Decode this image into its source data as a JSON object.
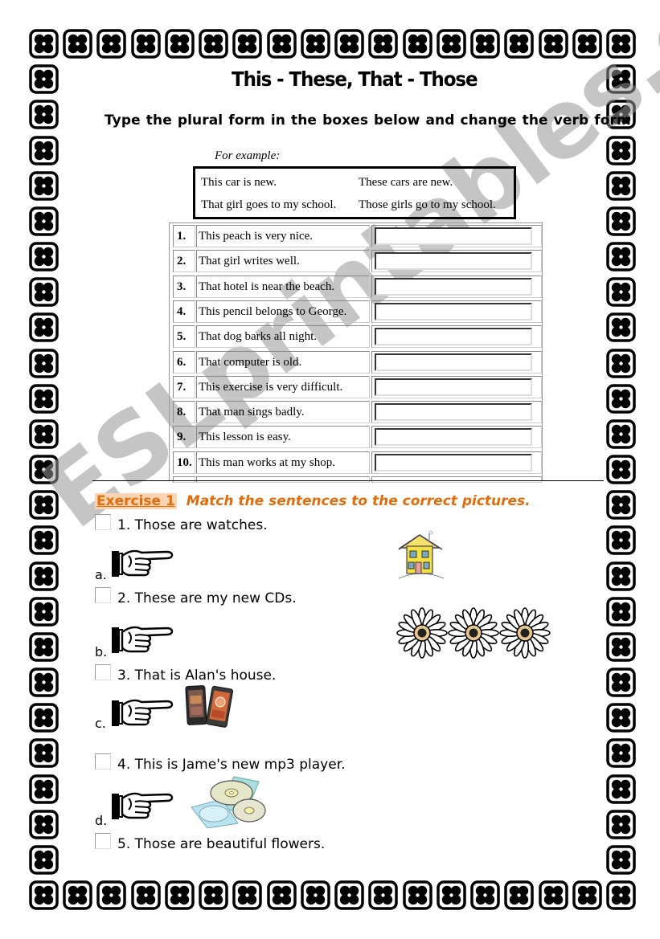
{
  "worksheet": {
    "title": "This - These, That - Those",
    "instruction": "Type the plural form in the boxes below and change the verb form",
    "example": {
      "label": "For example:",
      "rows": [
        {
          "singular": "This car is new.",
          "plural": "These cars are new."
        },
        {
          "singular": "That girl goes to my school.",
          "plural": "Those girls go to my school."
        }
      ]
    },
    "exercise_rows": [
      {
        "num": "1.",
        "sentence": "This peach is very nice.",
        "answer": ""
      },
      {
        "num": "2.",
        "sentence": "That girl writes well.",
        "answer": ""
      },
      {
        "num": "3.",
        "sentence": "That hotel is near the beach.",
        "answer": ""
      },
      {
        "num": "4.",
        "sentence": "This pencil belongs to George.",
        "answer": ""
      },
      {
        "num": "5.",
        "sentence": "That dog barks all night.",
        "answer": ""
      },
      {
        "num": "6.",
        "sentence": "That computer is old.",
        "answer": ""
      },
      {
        "num": "7.",
        "sentence": "This exercise is very difficult.",
        "answer": ""
      },
      {
        "num": "8.",
        "sentence": "That man sings badly.",
        "answer": ""
      },
      {
        "num": "9.",
        "sentence": "This lesson is easy.",
        "answer": ""
      },
      {
        "num": "10.",
        "sentence": "This man works at my shop.",
        "answer": ""
      }
    ]
  },
  "exercise1": {
    "label": "Exercise 1",
    "task": "Match the sentences to the correct pictures.",
    "sentences": [
      "1. Those are watches.",
      "2. These are my new CDs.",
      "3. That is Alan's house.",
      "4. This is Jame's new mp3 player.",
      "5. Those are beautiful flowers."
    ],
    "letters": [
      "a.",
      "b.",
      "c.",
      "d."
    ],
    "pictures": {
      "house": "house-picture",
      "flowers": "daisy-flowers-picture",
      "phones": "mobile-phones-picture",
      "cds": "cds-picture"
    }
  },
  "watermark": "ESLprintables.com",
  "colors": {
    "accent": "#e36c0a",
    "highlight": "#fbd4b4",
    "watermark": "#969696"
  }
}
